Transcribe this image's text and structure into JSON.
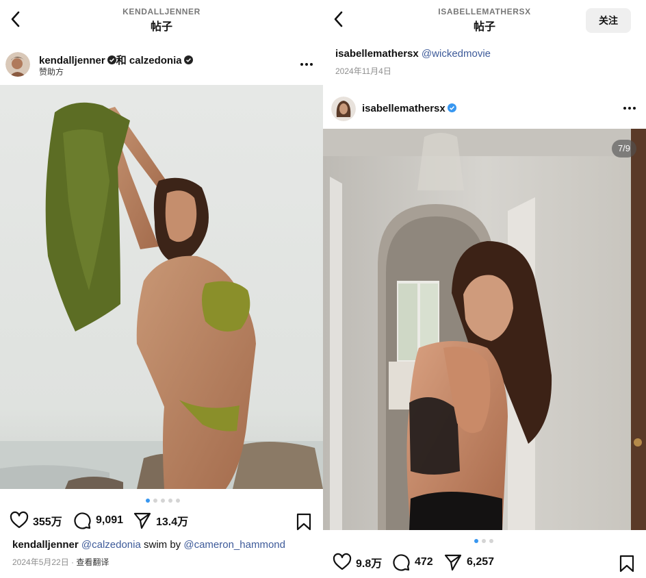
{
  "left": {
    "header": {
      "username": "KENDALLJENNER",
      "title": "帖子"
    },
    "post": {
      "author": "kendalljenner",
      "joiner": "和",
      "coauthor": "calzedonia",
      "sponsor_label": "赞助方",
      "slide_dots": 5,
      "active_dot": 0,
      "actions": {
        "likes": "355万",
        "comments": "9,091",
        "shares": "13.4万"
      },
      "caption": {
        "author": "kendalljenner",
        "mention1": "@calzedonia",
        "text": " swim by ",
        "mention2": "@cameron_hammond"
      },
      "date": "2024年5月22日",
      "separator": " · ",
      "translate_label": "查看翻译"
    }
  },
  "right": {
    "header": {
      "username": "ISABELLEMATHERSX",
      "title": "帖子",
      "follow_label": "关注"
    },
    "caption_top": {
      "author": "isabellemathersx",
      "mention": "@wickedmovie"
    },
    "date": "2024年11月4日",
    "post": {
      "author": "isabellemathersx",
      "counter": "7/9",
      "slide_dots": 3,
      "active_dot": 0,
      "actions": {
        "likes": "9.8万",
        "comments": "472",
        "shares": "6,257"
      }
    }
  },
  "colors": {
    "accent": "#3897f0",
    "verified": "#3897f0",
    "mention": "#3d5a99"
  }
}
